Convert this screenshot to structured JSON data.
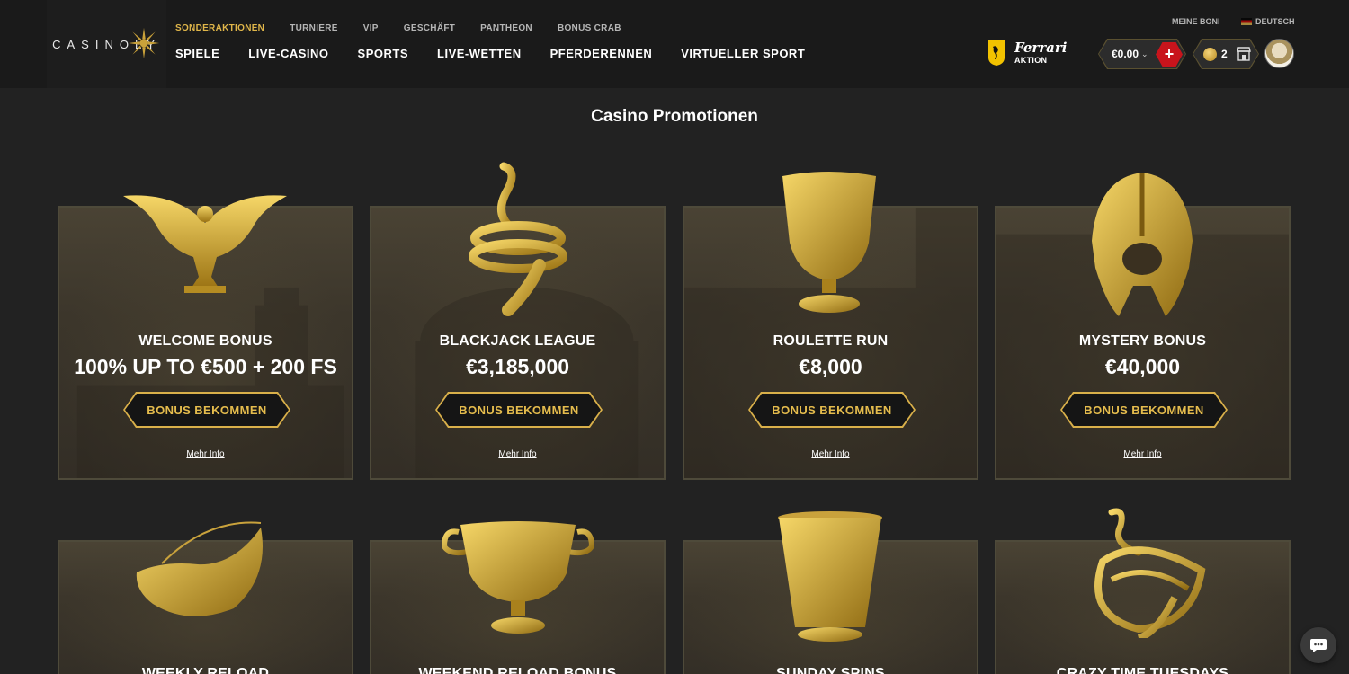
{
  "brand": {
    "logo_text": "CASINOLY"
  },
  "header": {
    "top_links": [
      {
        "label": "SONDERAKTIONEN",
        "active": true
      },
      {
        "label": "TURNIERE",
        "active": false
      },
      {
        "label": "VIP",
        "active": false
      },
      {
        "label": "GESCHÄFT",
        "active": false
      },
      {
        "label": "PANTHEON",
        "active": false
      },
      {
        "label": "BONUS CRAB",
        "active": false
      }
    ],
    "main_nav": [
      "SPIELE",
      "LIVE-CASINO",
      "SPORTS",
      "LIVE-WETTEN",
      "PFERDERENNEN",
      "VIRTUELLER SPORT"
    ],
    "ferrari": {
      "brand": "Ferrari",
      "sub": "AKTION"
    },
    "meine_boni": "MEINE BONI",
    "language": "DEUTSCH",
    "balance": "€0.00",
    "deposit_symbol": "+",
    "coins": "2"
  },
  "page_title": "Casino Promotionen",
  "cards": [
    {
      "name": "WELCOME BONUS",
      "value": "100% UP TO €500 + 200 FS",
      "button": "BONUS BEKOMMEN",
      "more": "Mehr Info",
      "artifact": "eagle-icon"
    },
    {
      "name": "BLACKJACK LEAGUE",
      "value": "€3,185,000",
      "button": "BONUS BEKOMMEN",
      "more": "Mehr Info",
      "artifact": "snake-ring-icon"
    },
    {
      "name": "ROULETTE RUN",
      "value": "€8,000",
      "button": "BONUS BEKOMMEN",
      "more": "Mehr Info",
      "artifact": "goblet-icon"
    },
    {
      "name": "MYSTERY BONUS",
      "value": "€40,000",
      "button": "BONUS BEKOMMEN",
      "more": "Mehr Info",
      "artifact": "helmet-icon"
    },
    {
      "name": "WEEKLY RELOAD",
      "artifact": "horn-icon"
    },
    {
      "name": "WEEKEND RELOAD BONUS",
      "artifact": "cup-icon"
    },
    {
      "name": "SUNDAY SPINS",
      "artifact": "vase-icon"
    },
    {
      "name": "CRAZY TIME TUESDAYS",
      "artifact": "snake-bracelet-icon"
    }
  ],
  "colors": {
    "accent_gold": "#e0b64a",
    "deposit_red": "#c8141c",
    "bg": "#222222",
    "header_bg": "#1a1a1a"
  }
}
